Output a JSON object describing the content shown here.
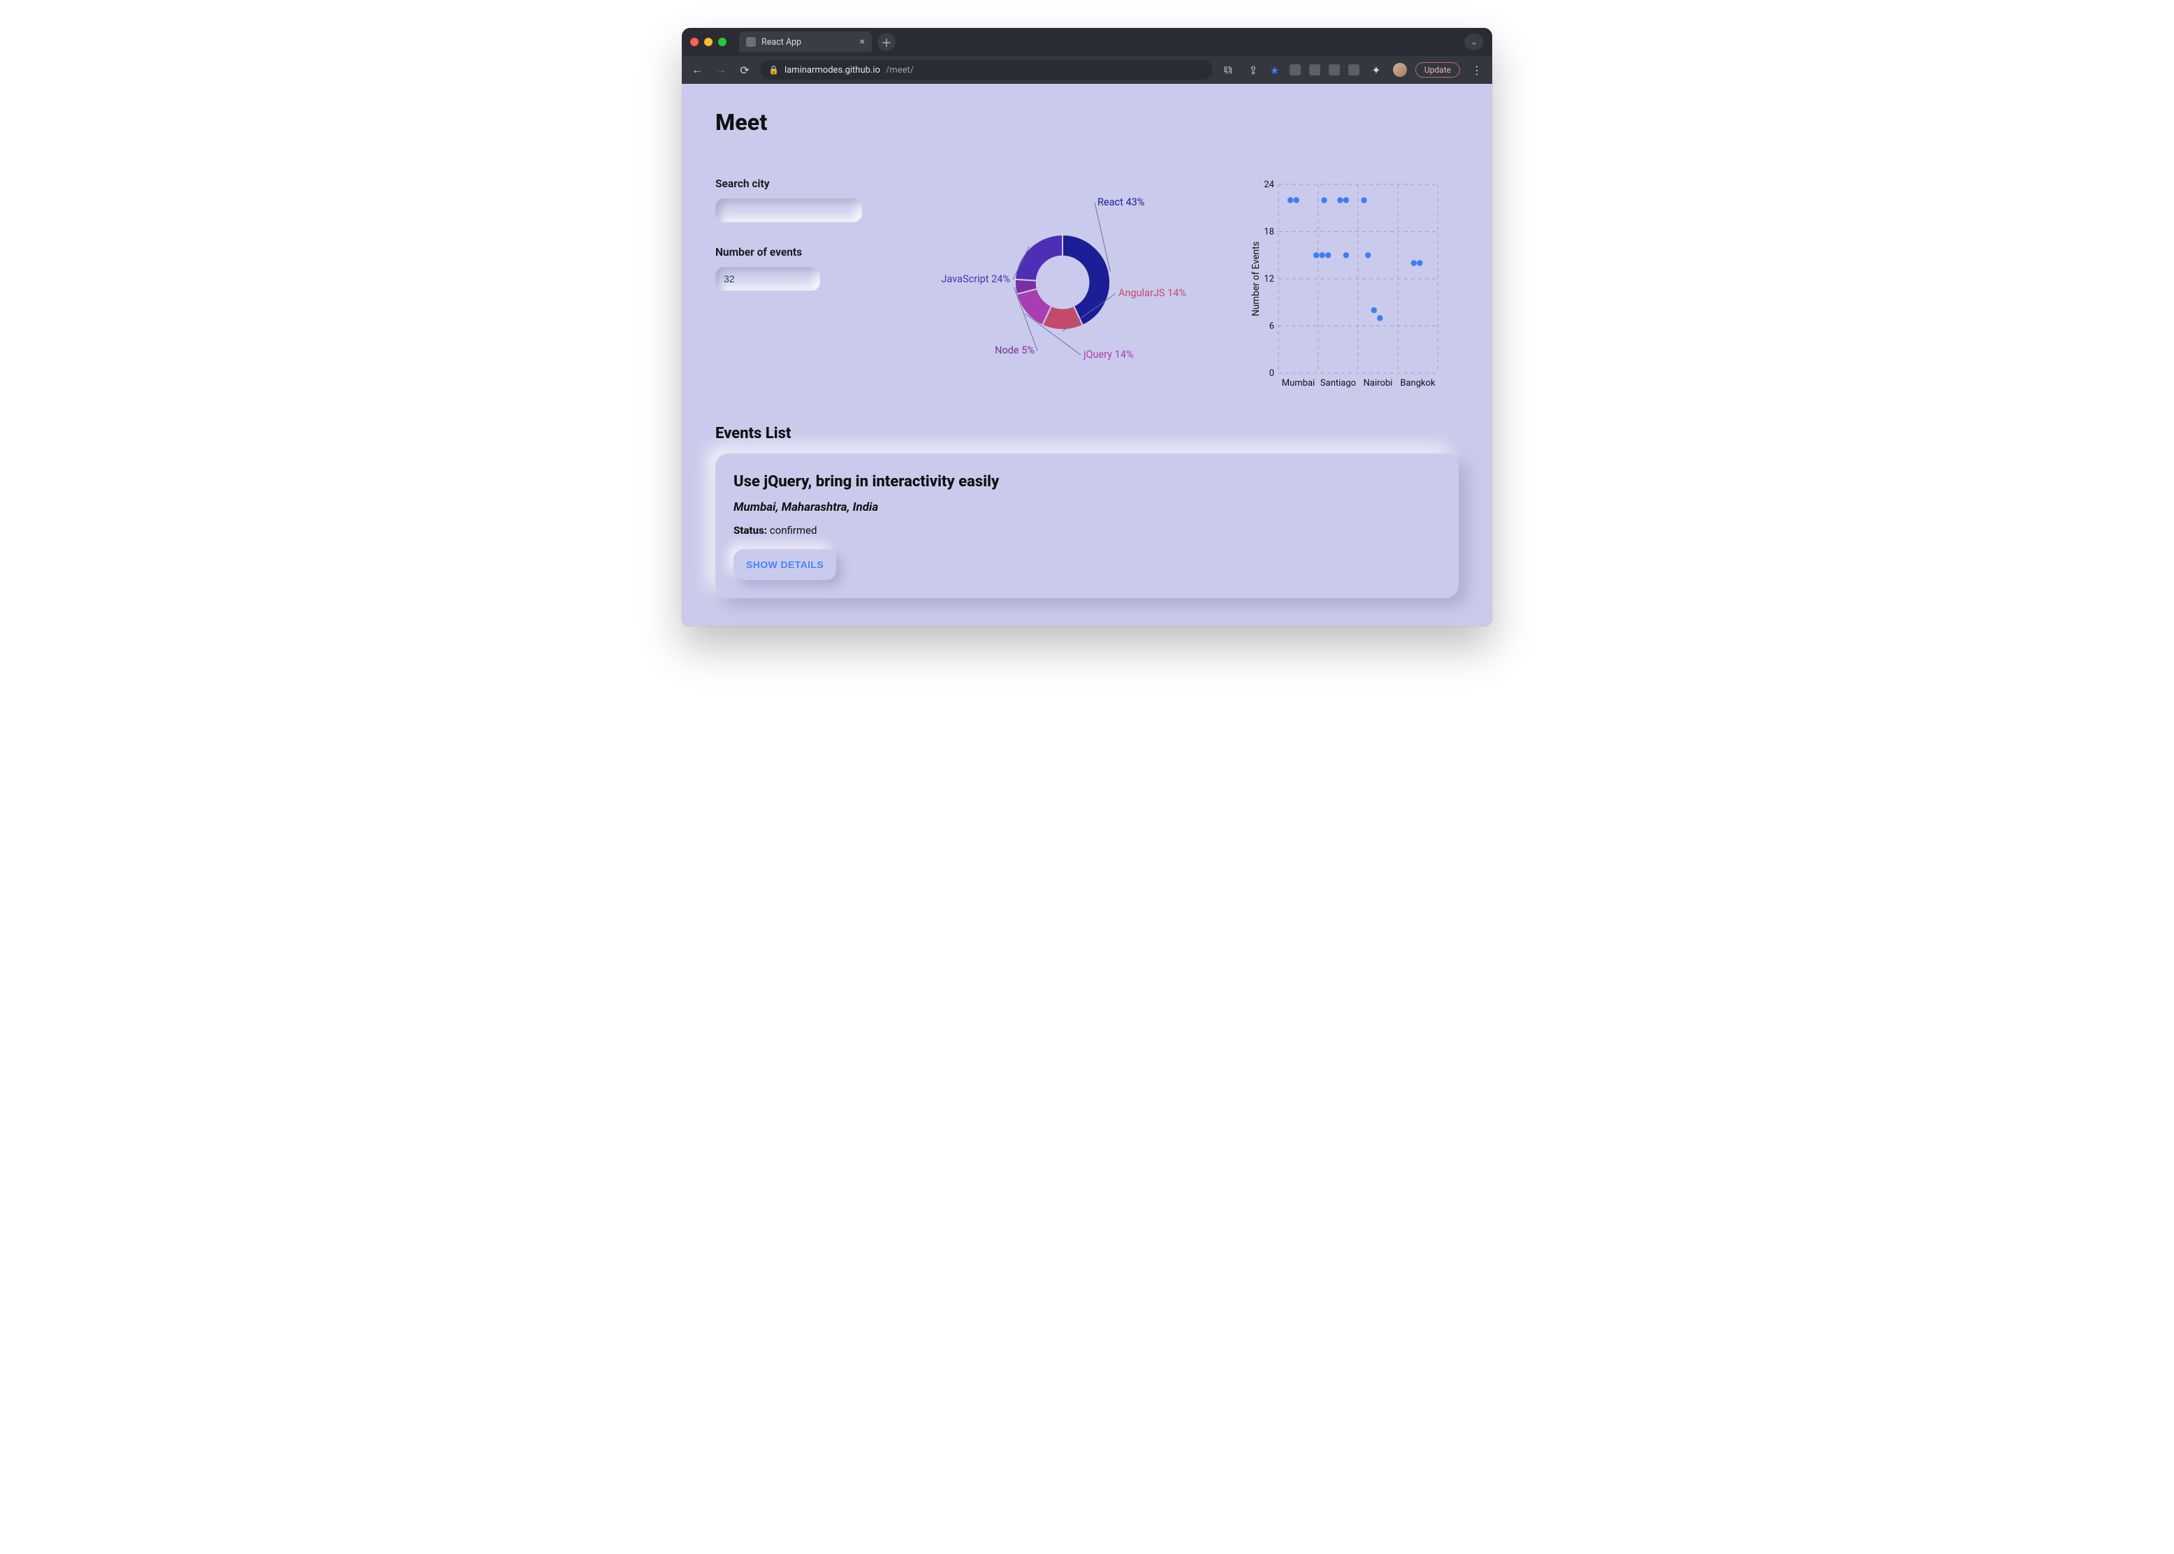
{
  "browser": {
    "tab_title": "React App",
    "new_tab_tooltip": "New Tab",
    "url_host": "laminarmodes.github.io",
    "url_path": "/meet/",
    "update_label": "Update"
  },
  "page": {
    "title": "Meet",
    "events_heading": "Events List"
  },
  "controls": {
    "search_label": "Search city",
    "search_value": "",
    "number_label": "Number of events",
    "number_value": "32"
  },
  "event_card": {
    "title": "Use jQuery, bring in interactivity easily",
    "location": "Mumbai, Maharashtra, India",
    "status_label": "Status:",
    "status_value": "confirmed",
    "button_label": "SHOW DETAILS"
  },
  "chart_data": [
    {
      "type": "pie",
      "title": "",
      "series": [
        {
          "name": "React",
          "value": 43,
          "color": "#1c1d97",
          "label": "React 43%"
        },
        {
          "name": "AngularJS",
          "value": 14,
          "color": "#c44a6a",
          "label": "AngularJS 14%"
        },
        {
          "name": "jQuery",
          "value": 14,
          "color": "#aa3db1",
          "label": "jQuery 14%"
        },
        {
          "name": "Node",
          "value": 5,
          "color": "#7a2fa2",
          "label": "Node 5%"
        },
        {
          "name": "JavaScript",
          "value": 24,
          "color": "#4d2fb5",
          "label": "JavaScript 24%"
        }
      ],
      "inner_radius": 0.55
    },
    {
      "type": "scatter",
      "ylabel": "Number of Events",
      "xlabel": "",
      "y_ticks": [
        0,
        6,
        12,
        18,
        24
      ],
      "ylim": [
        0,
        24
      ],
      "x_categories": [
        "Mumbai",
        "Santiago",
        "Nairobi",
        "Bangkok"
      ],
      "points": [
        {
          "xi": 0.15,
          "y": 22
        },
        {
          "xi": 0.3,
          "y": 22
        },
        {
          "xi": 1.0,
          "y": 22
        },
        {
          "xi": 1.4,
          "y": 22
        },
        {
          "xi": 1.55,
          "y": 22
        },
        {
          "xi": 2.0,
          "y": 22
        },
        {
          "xi": 0.8,
          "y": 15
        },
        {
          "xi": 0.95,
          "y": 15
        },
        {
          "xi": 1.1,
          "y": 15
        },
        {
          "xi": 1.55,
          "y": 15
        },
        {
          "xi": 2.1,
          "y": 15
        },
        {
          "xi": 3.25,
          "y": 14
        },
        {
          "xi": 3.4,
          "y": 14
        },
        {
          "xi": 2.25,
          "y": 8
        },
        {
          "xi": 2.4,
          "y": 7
        }
      ]
    }
  ]
}
